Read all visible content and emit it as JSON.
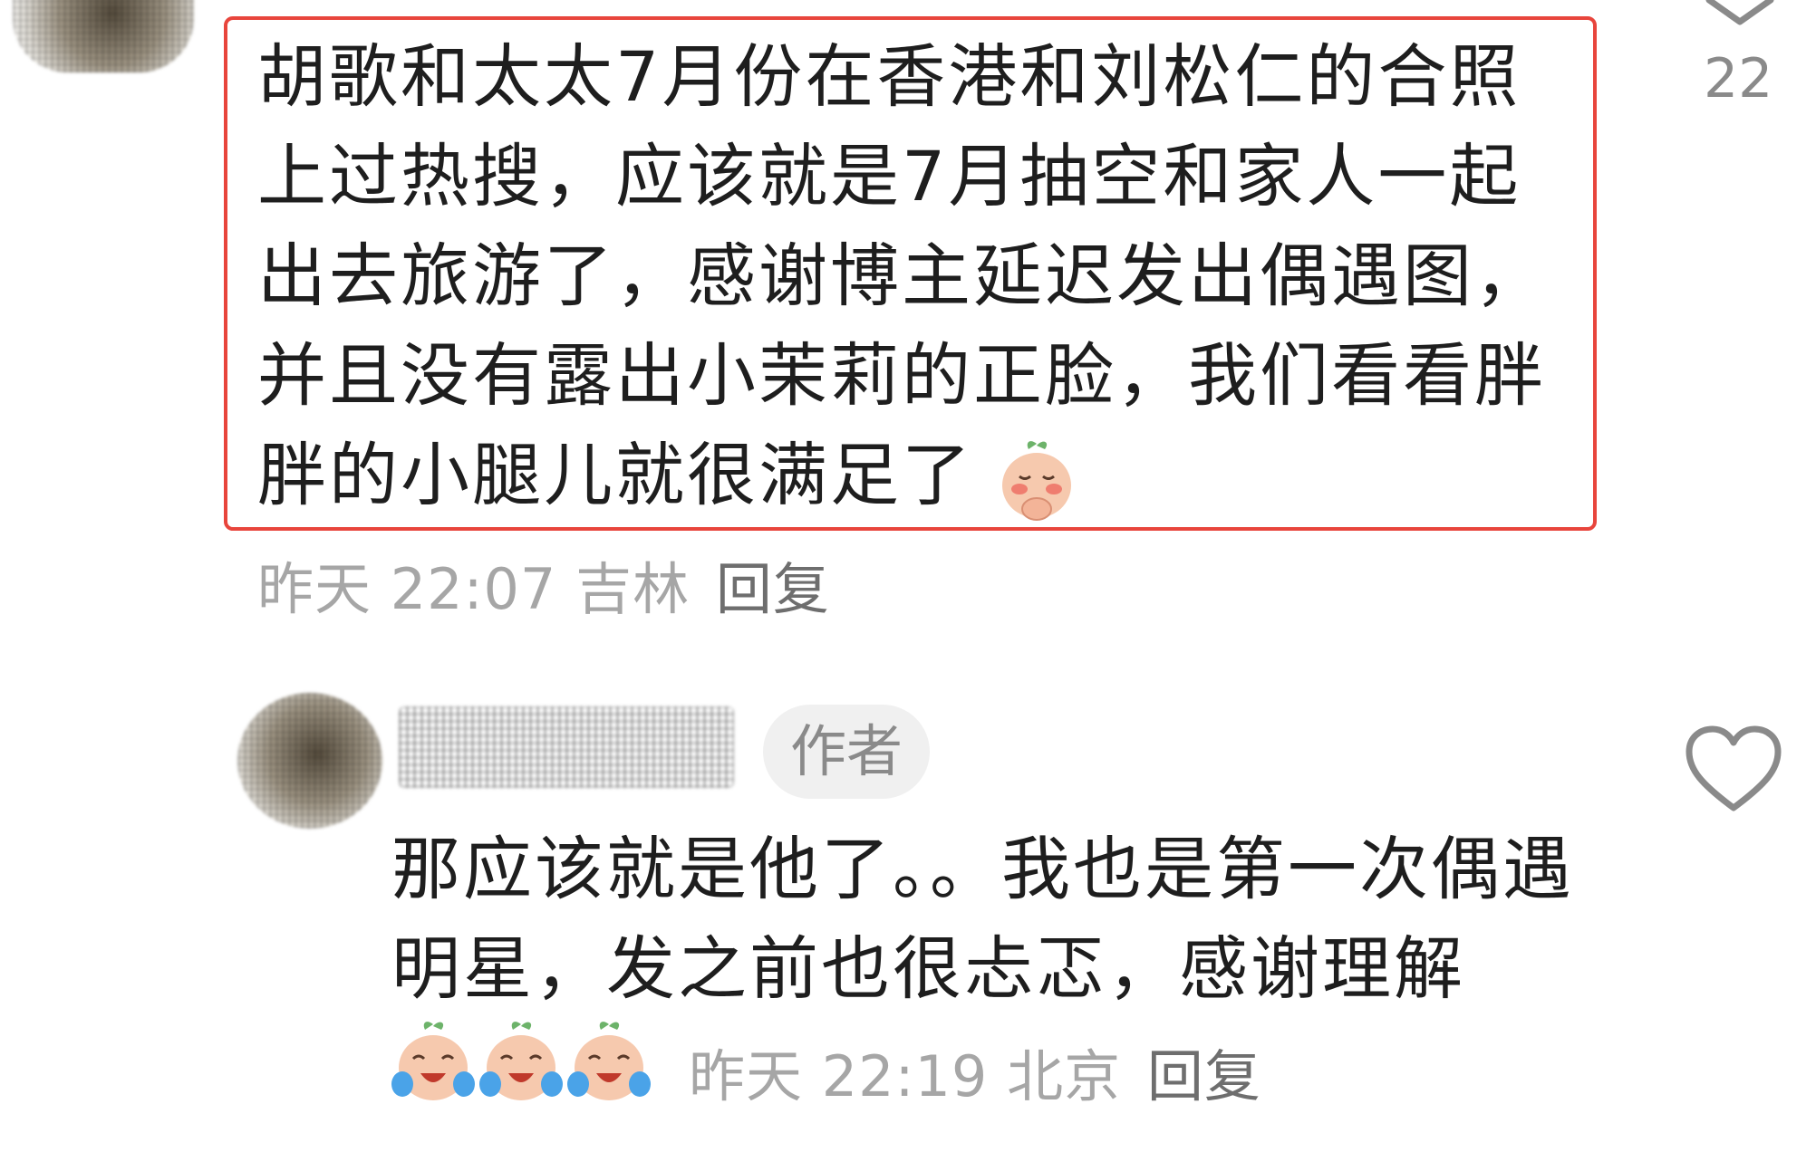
{
  "comments": [
    {
      "text": "胡歌和太太7月份在香港和刘松仁的合照上过热搜，应该就是7月抽空和家人一起出去旅游了，感谢博主延迟发出偶遇图，并且没有露出小茉莉的正脸，我们看看胖胖的小腿儿就很满足了",
      "emoji": "peach-pray-emoji",
      "time": "昨天 22:07",
      "location": "吉林",
      "reply_label": "回复",
      "like_count": "22"
    },
    {
      "author_badge": "作者",
      "text": "那应该就是他了。。我也是第一次偶遇明星，发之前也很忐忑，感谢理解",
      "emoji": "peach-crying-laugh-emoji",
      "emoji_count": 3,
      "time": "昨天 22:19",
      "location": "北京",
      "reply_label": "回复"
    }
  ],
  "colors": {
    "highlight_border": "#e8453c",
    "text": "#1e1e1e",
    "meta": "#a6a6a6",
    "badge_bg": "#f0f0f0"
  }
}
